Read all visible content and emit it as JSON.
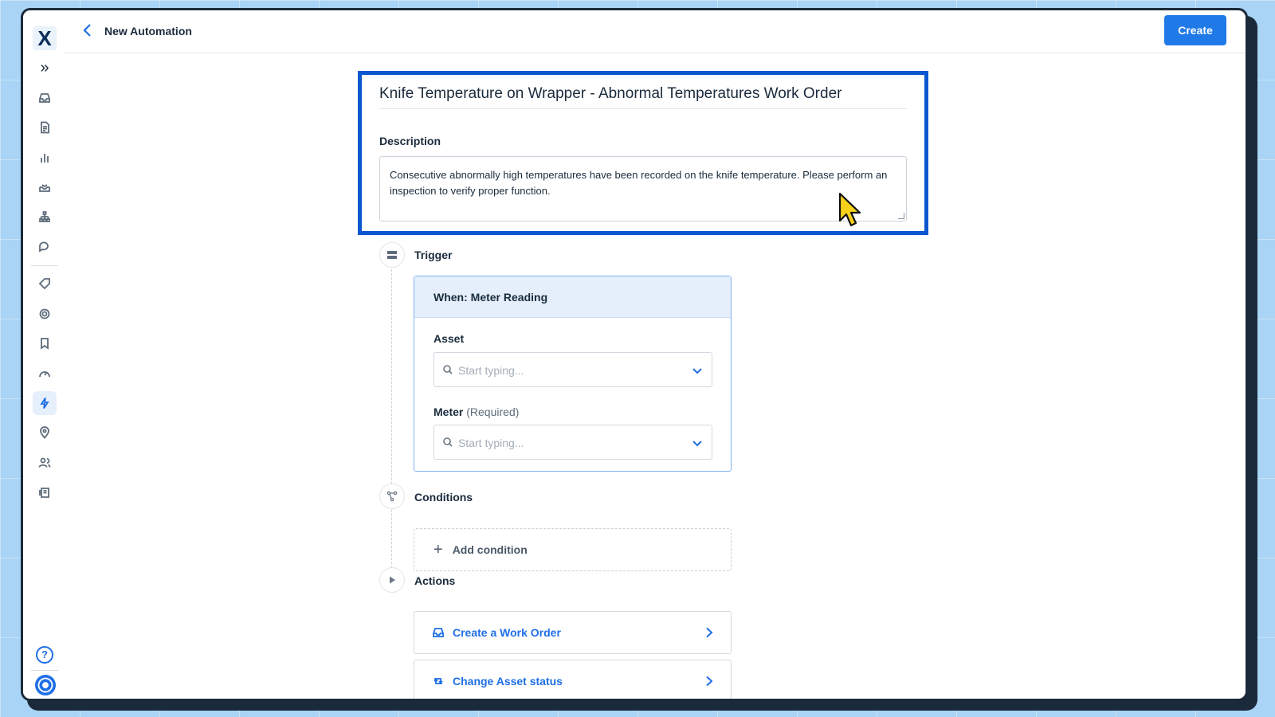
{
  "header": {
    "title": "New Automation",
    "create_label": "Create"
  },
  "automation": {
    "title": "Knife Temperature on Wrapper - Abnormal Temperatures Work Order",
    "description_label": "Description",
    "description": "Consecutive abnormally high temperatures have been recorded on the knife temperature. Please perform an inspection to verify proper function."
  },
  "trigger": {
    "label": "Trigger",
    "when": "When: Meter Reading",
    "asset_label": "Asset",
    "asset_placeholder": "Start typing...",
    "meter_label": "Meter",
    "meter_required": "(Required)",
    "meter_placeholder": "Start typing..."
  },
  "conditions": {
    "label": "Conditions",
    "add_label": "Add condition"
  },
  "actions": {
    "label": "Actions",
    "items": [
      {
        "label": "Create a Work Order",
        "icon": "inbox-icon"
      },
      {
        "label": "Change Asset status",
        "icon": "refresh-icon"
      }
    ]
  },
  "sidebar": {
    "logo": "X",
    "help": "?",
    "active_item": "automations"
  },
  "colors": {
    "accent": "#1f7ae8",
    "highlight_border": "#0b57d0"
  }
}
